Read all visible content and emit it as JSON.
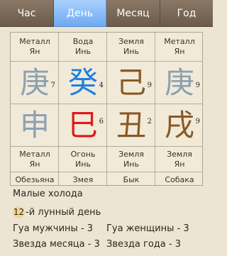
{
  "tabs": [
    {
      "label": "Час"
    },
    {
      "label": "День"
    },
    {
      "label": "Месяц"
    },
    {
      "label": "Год"
    }
  ],
  "active_tab": 1,
  "pillars": [
    {
      "top_element": {
        "line1": "Металл",
        "line2": "Ян"
      },
      "stem": "庚",
      "stem_num": "7",
      "stem_color": "#8da1b0",
      "branch": "申",
      "branch_num": "",
      "branch_color": "#8da1b0",
      "bottom_element": {
        "line1": "Металл",
        "line2": "Ян"
      },
      "animal": "Обезьяна"
    },
    {
      "top_element": {
        "line1": "Вода",
        "line2": "Инь"
      },
      "stem": "癸",
      "stem_num": "4",
      "stem_color": "#1f7fe0",
      "branch": "巳",
      "branch_num": "6",
      "branch_color": "#e01818",
      "bottom_element": {
        "line1": "Огонь",
        "line2": "Инь"
      },
      "animal": "Змея"
    },
    {
      "top_element": {
        "line1": "Земля",
        "line2": "Инь"
      },
      "stem": "己",
      "stem_num": "9",
      "stem_color": "#8a5a22",
      "branch": "丑",
      "branch_num": "2",
      "branch_color": "#8a5a22",
      "bottom_element": {
        "line1": "Земля",
        "line2": "Инь"
      },
      "animal": "Бык"
    },
    {
      "top_element": {
        "line1": "Металл",
        "line2": "Ян"
      },
      "stem": "庚",
      "stem_num": "9",
      "stem_color": "#8da1b0",
      "branch": "戌",
      "branch_num": "9",
      "branch_color": "#8a5a22",
      "bottom_element": {
        "line1": "Земля",
        "line2": "Ян"
      },
      "animal": "Собака"
    }
  ],
  "info": {
    "solar_term": "Малые холода",
    "lunar_day_number": "12",
    "lunar_day_suffix": "-й лунный день",
    "gua_male": "Гуа мужчины - 3",
    "gua_female": "Гуа женщины - 3",
    "month_star": "Звезда месяца - 3",
    "year_star": "Звезда года - 3"
  }
}
